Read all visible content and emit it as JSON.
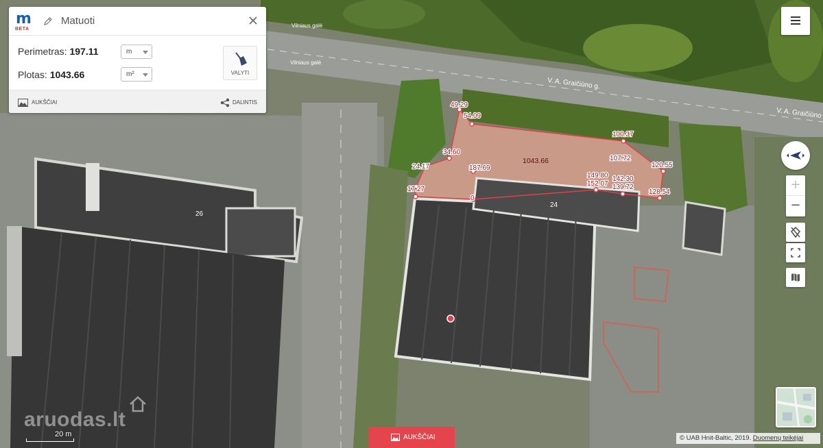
{
  "panel": {
    "logo_letter": "m",
    "logo_badge": "BETA",
    "title": "Matuoti",
    "perimeter_label": "Perimetras:",
    "perimeter_value": "197.11",
    "perimeter_unit": "m",
    "area_label": "Plotas:",
    "area_value": "1043.66",
    "area_unit": "m²",
    "clear_label": "VALYTI",
    "footer_heights_label": "AUKŠČIAI",
    "footer_share_label": "DALINTIS"
  },
  "map": {
    "street_labels": [
      "V. A. Graičiūno g.",
      "V. A. Graičiūno g.",
      "Vilniaus galė",
      "Vilniaus galė"
    ],
    "building_numbers": [
      "26",
      "24"
    ],
    "measure_area_label": "1043.66",
    "vertex_labels": [
      "49.29",
      "54.09",
      "100.37",
      "34.60",
      "24.17",
      "187.69",
      "107.72",
      "120.55",
      "17.27",
      "149.80",
      "152.07",
      "142.30",
      "139.72",
      "128.54",
      "0"
    ]
  },
  "controls": {
    "zoom_in": "+",
    "zoom_out": "−",
    "icons": [
      "menu-icon",
      "compass-icon",
      "location-off-icon",
      "fullscreen-icon",
      "map-layers-icon"
    ]
  },
  "bottom": {
    "heights_button_label": "AUKŠČIAI",
    "copyright_prefix": "© UAB Hnit-Baltic, 2019. ",
    "copyright_link": "Duomenų teikėjai",
    "scale_label": "20 m",
    "watermark": "aruodas.lt"
  },
  "colors": {
    "measure_line": "#e2404a",
    "brand_blue": "#1c5fa8",
    "heights_button": "#e6444c"
  }
}
